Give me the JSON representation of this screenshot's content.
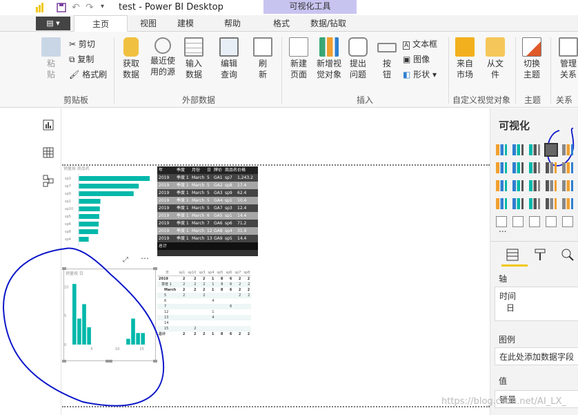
{
  "window": {
    "title": "test - Power BI Desktop",
    "context_tab": "可视化工具"
  },
  "tabs": {
    "file": "",
    "home": "主页",
    "view": "视图",
    "modeling": "建模",
    "help": "帮助",
    "format": "格式",
    "data_drill": "数据/钻取"
  },
  "ribbon": {
    "paste": "粘\n贴",
    "cut": "剪切",
    "copy": "复制",
    "format_painter": "格式刷",
    "get_data": "获取\n数据",
    "recent_sources": "最近使\n用的源",
    "enter_data": "输入\n数据",
    "edit_queries": "编辑\n查询",
    "refresh": "刷\n新",
    "new_page": "新建\n页面",
    "new_visual": "新增视\n觉对象",
    "ask_question": "提出\n问题",
    "button": "按\n钮",
    "text_box": "文本框",
    "image": "图像",
    "shapes": "形状",
    "from_market": "来自\n市场",
    "from_file": "从文\n件",
    "switch_theme": "切换\n主题",
    "manage_rel": "管理\n关系",
    "groups": {
      "clipboard": "剪贴板",
      "external": "外部数据",
      "insert": "插入",
      "custom": "自定义视觉对象",
      "themes": "主题",
      "relations": "关系"
    }
  },
  "pane": {
    "title": "可视化",
    "more": "...",
    "axis_label": "轴",
    "axis_field1": "时间",
    "axis_field2": "日",
    "legend_label": "图例",
    "legend_placeholder": "在此处添加数据字段",
    "value_label": "值",
    "value_field": "销量"
  },
  "visuals": {
    "bar_title": "销量按 商品名",
    "bar_categories": [
      "sp3",
      "sp7",
      "sp9",
      "sp1",
      "sp10",
      "sp5",
      "sp6",
      "sp8",
      "sp4"
    ],
    "bar_values": [
      1241,
      1050,
      960,
      380,
      370,
      360,
      350,
      340,
      175
    ],
    "bar_xmax": 1300,
    "col_title": "销量按 日",
    "col_values": [
      10.5,
      4.5,
      7,
      3,
      0,
      0,
      0,
      0,
      0,
      0,
      0,
      1,
      4.5,
      2,
      2
    ],
    "col_ymax": 11,
    "col_yticks": [
      "10",
      "5",
      "0"
    ],
    "col_xticks": [
      "5",
      "10",
      "15"
    ],
    "table_headers": [
      "年",
      "季度",
      "月份",
      "日",
      "牌价",
      "商品名",
      "价格"
    ],
    "table_rows": [
      [
        "2019",
        "季度 1",
        "March",
        "5",
        "GA1",
        "sp7",
        "1,243.2"
      ],
      [
        "2019",
        "季度 1",
        "March",
        "5",
        "GA2",
        "sp8",
        "17.4"
      ],
      [
        "2019",
        "季度 1",
        "March",
        "5",
        "GA3",
        "sp9",
        "62.4"
      ],
      [
        "2019",
        "季度 1",
        "March",
        "5",
        "GA4",
        "sp1",
        "10.4"
      ],
      [
        "2019",
        "季度 1",
        "March",
        "5",
        "GA7",
        "sp3",
        "12.4"
      ],
      [
        "2019",
        "季度 1",
        "March",
        "6",
        "GA5",
        "sp1",
        "14.4"
      ],
      [
        "2019",
        "季度 1",
        "March",
        "7",
        "GA6",
        "sp6",
        "71.2"
      ],
      [
        "2019",
        "季度 1",
        "March",
        "12",
        "GA8",
        "sp4",
        "31.9"
      ],
      [
        "2019",
        "季度 1",
        "March",
        "13",
        "GA9",
        "sp5",
        "14.4"
      ]
    ],
    "table_total": "总计",
    "matrix_headers": [
      "年",
      "sp1",
      "sp10",
      "sp3",
      "sp4",
      "sp5",
      "sp6",
      "sp7",
      "sp8"
    ],
    "matrix_rows": [
      [
        "2019",
        "2",
        "2",
        "2",
        "1",
        "8",
        "6",
        "2",
        "2"
      ],
      [
        "季度 1",
        "2",
        "2",
        "2",
        "1",
        "8",
        "6",
        "2",
        "2"
      ],
      [
        "March",
        "2",
        "2",
        "2",
        "1",
        "8",
        "6",
        "2",
        "2"
      ],
      [
        "5",
        "2",
        "",
        "2",
        "",
        "",
        "",
        "2",
        "2"
      ],
      [
        "6",
        "",
        "",
        "",
        "4",
        "",
        "",
        "",
        ""
      ],
      [
        "7",
        "",
        "",
        "",
        "",
        "",
        "6",
        "",
        ""
      ],
      [
        "12",
        "",
        "",
        "",
        "1",
        "",
        "",
        "",
        ""
      ],
      [
        "13",
        "",
        "",
        "",
        "4",
        "",
        "",
        "",
        ""
      ],
      [
        "14",
        "",
        "",
        "",
        "",
        "",
        "",
        "",
        ""
      ],
      [
        "15",
        "",
        "2",
        "",
        "",
        "",
        "",
        "",
        ""
      ],
      [
        "总计",
        "2",
        "2",
        "2",
        "1",
        "8",
        "6",
        "2",
        "2"
      ]
    ]
  },
  "watermark": "https://blog.csdn.net/AI_LX_"
}
